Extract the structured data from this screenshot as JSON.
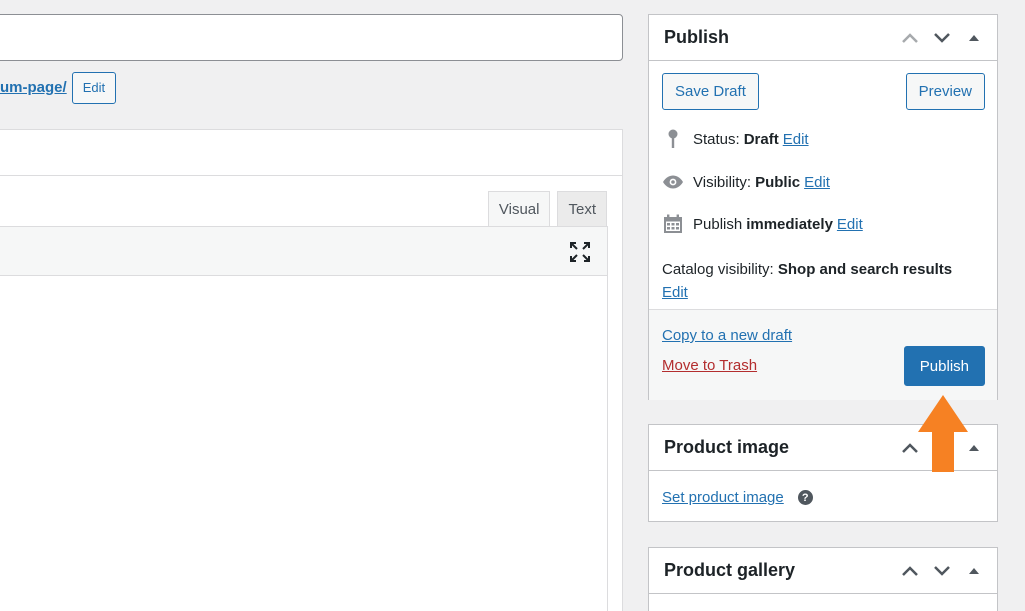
{
  "permalink": {
    "slug": "um-page/",
    "edit_label": "Edit"
  },
  "editor": {
    "tab_visual": "Visual",
    "tab_text": "Text"
  },
  "publish": {
    "title": "Publish",
    "save_draft": "Save Draft",
    "preview": "Preview",
    "status_label": "Status:",
    "status_value": "Draft",
    "visibility_label": "Visibility:",
    "visibility_value": "Public",
    "publish_label": "Publish",
    "publish_value": "immediately",
    "catalog_label": "Catalog visibility:",
    "catalog_value": "Shop and search results",
    "edit_label": "Edit",
    "copy_draft": "Copy to a new draft",
    "move_trash": "Move to Trash",
    "publish_button": "Publish"
  },
  "product_image": {
    "title": "Product image",
    "set_link": "Set product image",
    "help": "?"
  },
  "product_gallery": {
    "title": "Product gallery"
  },
  "colors": {
    "accent": "#2271b1",
    "danger": "#b32d2e",
    "arrow": "#f68123"
  }
}
